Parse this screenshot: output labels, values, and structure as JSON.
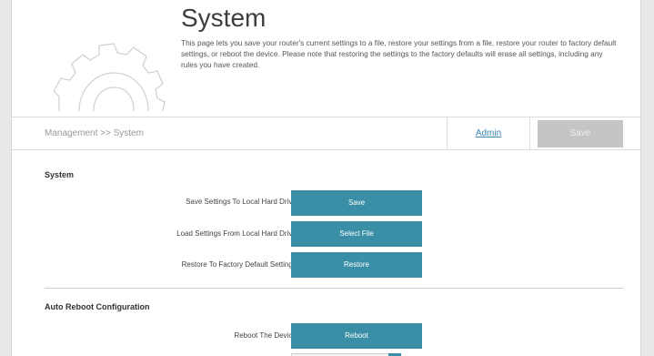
{
  "header": {
    "title": "System",
    "description": "This page lets you save your router's current settings to a file, restore your settings from a file, restore your router to factory default settings, or reboot the device. Please note that restoring the settings to the factory defaults will erase all settings, including any rules you have created.",
    "icon": "gear-icon"
  },
  "breadcrumb": {
    "text": "Management >> System",
    "admin_tab": "Admin",
    "save_label": "Save"
  },
  "system_section": {
    "title": "System",
    "rows": [
      {
        "label": "Save Settings To Local Hard Drive:",
        "button": "Save"
      },
      {
        "label": "Load Settings From Local Hard Drive:",
        "button": "Select File"
      },
      {
        "label": "Restore To Factory Default Settings:",
        "button": "Restore"
      }
    ]
  },
  "auto_reboot_section": {
    "title": "Auto Reboot Configuration",
    "rows": [
      {
        "label": "Reboot The Device:",
        "button": "Reboot"
      }
    ]
  },
  "colors": {
    "accent": "#3a8ea6",
    "link": "#3a87b8",
    "disabled": "#c5c5c5"
  }
}
